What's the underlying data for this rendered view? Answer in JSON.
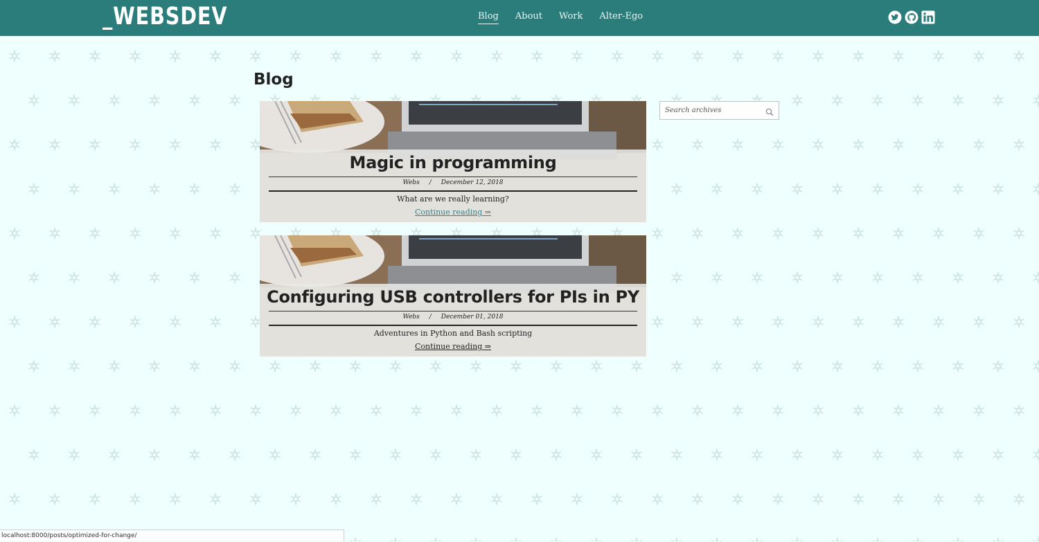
{
  "header": {
    "logo": "_WEBSDEV",
    "nav": [
      {
        "label": "Blog",
        "active": true
      },
      {
        "label": "About",
        "active": false
      },
      {
        "label": "Work",
        "active": false
      },
      {
        "label": "Alter-Ego",
        "active": false
      }
    ],
    "social_icons": [
      "twitter-icon",
      "github-icon",
      "linkedin-icon"
    ]
  },
  "main": {
    "title": "Blog",
    "posts": [
      {
        "title": "Magic in programming",
        "author": "Webs",
        "separator": "/",
        "date": "December 12, 2018",
        "excerpt": "What are we really learning?",
        "link": "Continue reading ⇒"
      },
      {
        "title": "Configuring USB controllers for PIs in PY",
        "author": "Webs",
        "separator": "/",
        "date": "December 01, 2018",
        "excerpt": "Adventures in Python and Bash scripting",
        "link": "Continue reading ⇒"
      }
    ]
  },
  "sidebar": {
    "search_placeholder": "Search archives",
    "search_icon": "search-icon"
  },
  "status_bar": {
    "url": "localhost:8000/posts/optimized-for-change/"
  },
  "colors": {
    "header_bg": "#2a7d7b",
    "page_bg": "#effffe",
    "link_hover": "#3d7f84"
  }
}
